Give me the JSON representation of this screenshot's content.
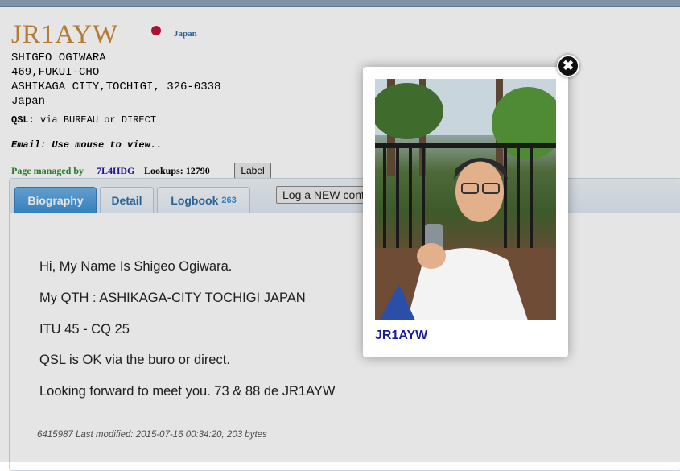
{
  "header": {
    "callsign": "JR1AYW",
    "country_link": "Japan",
    "name": "SHIGEO OGIWARA",
    "address_line1": "469,FUKUI-CHO",
    "address_line2": "ASHIKAGA CITY,TOCHIGI, 326-0338",
    "address_country": "Japan",
    "qsl_label": "QSL:",
    "qsl_value": "via BUREAU or DIRECT",
    "email_text": "Email: Use mouse to view..",
    "managed_label": "Page managed by",
    "managed_by": "7L4HDG",
    "lookups_label": "Lookups:",
    "lookups_value": "12790",
    "label_button": "Label"
  },
  "tabs": [
    {
      "label": "Biography",
      "count": ""
    },
    {
      "label": "Detail",
      "count": ""
    },
    {
      "label": "Logbook",
      "count": "263"
    }
  ],
  "log_new_button": "Log a NEW contact",
  "biography": {
    "lines": [
      "Hi, My Name Is Shigeo Ogiwara.",
      "My QTH : ASHIKAGA-CITY TOCHIGI JAPAN",
      "ITU 45 - CQ 25",
      "QSL is OK via the buro or direct.",
      "Looking forward to meet you. 73 & 88 de JR1AYW"
    ],
    "footer": "6415987 Last modified: 2015-07-16 00:34:20, 203 bytes"
  },
  "modal": {
    "caption": "JR1AYW",
    "close_glyph": "✖"
  },
  "colors": {
    "callsign": "#c8893a",
    "tab_active": "#3a8fd4",
    "link_blue": "#1a1aa0",
    "managed_green": "#2e8b2e"
  }
}
